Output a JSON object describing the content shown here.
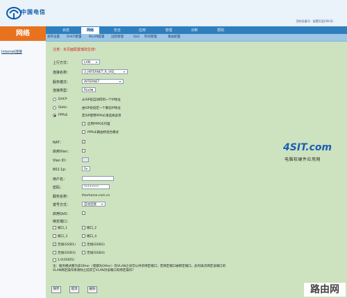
{
  "header": {
    "logo_text": "中国电信",
    "info": "您的设备号：配置页面(SN-D)"
  },
  "left_nav": {
    "title": "网络",
    "link": "Internet连接"
  },
  "tabs": [
    "状态",
    "网络",
    "安全",
    "应用",
    "管理",
    "诊断",
    "帮助"
  ],
  "subtabs": [
    "宽带设置",
    "DHCP配置",
    "WLAN配置",
    "远程管理",
    "QoS",
    "时间管理",
    "路由配置"
  ],
  "form": {
    "warning": "注意：本页面配置慎改生效!",
    "uplink_label": "上行方式：",
    "uplink_value": "LAN",
    "conn_name_label": "连接名称：",
    "conn_name_value": "3_INTERNET_R_VID_",
    "service_mode_label": "服务模式：",
    "service_mode_value": "INTERNET",
    "conn_type_label": "连接类型：",
    "conn_type_value": "Route",
    "dhcp_label": "DHCP",
    "dhcp_desc": "从ISP处自动得到一个IP地址",
    "static_label": "Static",
    "static_desc": "由ISP处指定一个静态IP地址",
    "pppoe_label": "PPPoE",
    "pppoe_desc": "若ISP使用PPPoE请选择此项",
    "pppoe_proxy": "启用PPPOE代理",
    "pppoe_bridge": "PPPoE路由桥混合模式",
    "nat_label": "NAT：",
    "vlan_enable_label": "启用Vlan：",
    "vlan_id_label": "Vlan ID：",
    "pri_label": "802.1p：",
    "pri_value": "0",
    "username_label": "用户名：",
    "username_value": "",
    "password_label": "密码：",
    "password_value": "••••••••",
    "service_name_label": "服务名称：",
    "service_name_value": "lfserhome.com.cn",
    "dial_mode_label": "拨号方式：",
    "dial_mode_value": "自动连接",
    "qos_label": "启用QoS：",
    "bind_port_label": "绑定端口：",
    "ports": [
      "端口_1",
      "端口_2",
      "端口_3",
      "端口_4",
      "无线(SSID1)",
      "无线(SSID2)",
      "无线(SSID3)",
      "无线(SSID4)"
    ],
    "ipv6_label": "1.0(SSID5)",
    "foot_note": "注：服务模式都为非Other（或都为Other）的VLAN之间可以共享绑定端口；若绑定端口被绑定端口，此时再次绑定该端口的VLAN绑定操作将清除之前其它VLAN对该端口的绑定操作？",
    "btn_save": "保存",
    "btn_cancel": "取消",
    "btn_delete": "删除"
  },
  "watermark": {
    "site": "4SIT.com",
    "site_sub": "电脑软硬件应用网",
    "corner": "路由网"
  }
}
